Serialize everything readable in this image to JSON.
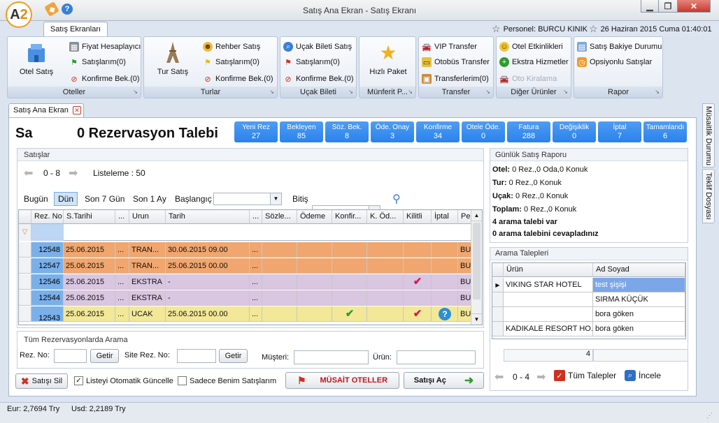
{
  "window": {
    "title": "Satış Ana Ekran - Satış Ekranı",
    "logo_text": "A",
    "logo_num": "2"
  },
  "ribbon_tab": "Satış Ekranları",
  "header_right": {
    "personel": "Personel: BURCU KINIK",
    "date": "26 Haziran 2015 Cuma 01:40:01"
  },
  "ribbon": {
    "oteller": {
      "label": "Oteller",
      "big": "Otel Satış",
      "items": [
        "Fiyat Hesaplayıcı",
        "Satışlarım(0)",
        "Konfirme Bek.(0)"
      ]
    },
    "turlar": {
      "label": "Turlar",
      "big": "Tur Satış",
      "items": [
        "Rehber Satış",
        "Satışlarım(0)",
        "Konfirme Bek.(0)"
      ]
    },
    "ucak": {
      "label": "Uçak Bileti",
      "items": [
        "Uçak Bileti Satış",
        "Satışlarım(0)",
        "Konfirme Bek.(0)"
      ]
    },
    "munferit": {
      "label": "Münferit P...",
      "big": "Hızlı Paket"
    },
    "transfer": {
      "label": "Transfer",
      "items": [
        "VIP Transfer",
        "Otobüs Transfer",
        "Transferlerim(0)"
      ]
    },
    "diger": {
      "label": "Diğer Ürünler",
      "items": [
        "Otel Etkinlikleri",
        "Ekstra Hizmetler",
        "Oto Kiralama"
      ]
    },
    "rapor": {
      "label": "Rapor",
      "items": [
        "Satış Bakiye Durumu",
        "Opsiyonlu Satışlar"
      ]
    }
  },
  "doc_tab": "Satış Ana Ekran",
  "main_title_short": "Sa",
  "rez_title": "0 Rezervasyon Talebi",
  "tiles": [
    {
      "label": "Yeni Rez",
      "value": "27"
    },
    {
      "label": "Bekleyen",
      "value": "85"
    },
    {
      "label": "Söz. Bek.",
      "value": "8"
    },
    {
      "label": "Öde. Onay",
      "value": "3"
    },
    {
      "label": "Konfirme",
      "value": "34"
    },
    {
      "label": "Otele Öde.",
      "value": "0"
    },
    {
      "label": "Fatura",
      "value": "288"
    },
    {
      "label": "Değişiklik",
      "value": "0"
    },
    {
      "label": "İptal",
      "value": "7"
    },
    {
      "label": "Tamamlandı",
      "value": "6"
    }
  ],
  "satislar": {
    "title": "Satışlar",
    "range": "0 - 8",
    "listeleme": "Listeleme : 50",
    "filters": [
      "Bugün",
      "Dün",
      "Son 7 Gün",
      "Son 1 Ay"
    ],
    "baslangic": "Başlangıç",
    "bitis": "Bitiş",
    "columns": [
      "Rez. No",
      "S.Tarihi",
      "...",
      "Urun",
      "Tarih",
      "...",
      "Sözle...",
      "Ödeme",
      "Konfir...",
      "K. Öd...",
      "Kilitli",
      "İptal",
      "Pe"
    ],
    "rows": [
      {
        "rez": "12548",
        "starih": "25.06.2015",
        "dots": "...",
        "urun": "TRAN...",
        "tarih": "30.06.2015 09.00",
        "dots2": "...",
        "pe": "BU",
        "color": "#f0a66e"
      },
      {
        "rez": "12547",
        "starih": "25.06.2015",
        "dots": "...",
        "urun": "TRAN...",
        "tarih": "25.06.2015 00.00",
        "dots2": "...",
        "pe": "BU",
        "color": "#f0a66e"
      },
      {
        "rez": "12546",
        "starih": "25.06.2015",
        "dots": "...",
        "urun": "EKSTRA",
        "tarih": "-",
        "dots2": "...",
        "pe": "BU",
        "color": "#d9c6e0"
      },
      {
        "rez": "12544",
        "starih": "25.06.2015",
        "dots": "...",
        "urun": "EKSTRA",
        "tarih": "-",
        "dots2": "...",
        "pe": "BU",
        "color": "#d9c6e0"
      },
      {
        "rez": "12543",
        "starih": "25.06.2015",
        "dots": "...",
        "urun": "UCAK",
        "tarih": "25.06.2015 00.00",
        "dots2": "...",
        "pe": "BU",
        "color": "#f2e898"
      }
    ]
  },
  "arama": {
    "title": "Tüm Rezervasyonlarda Arama",
    "rez_no": "Rez. No:",
    "getir": "Getir",
    "site_rez_no": "Site Rez. No:",
    "musteri": "Müşteri:",
    "urun": "Ürün:"
  },
  "bottom": {
    "satisi_sil": "Satışı Sil",
    "otomatik": "Listeyi Otomatik Güncelle",
    "sadece": "Sadece Benim Satışlarım",
    "musait": "MÜSAİT OTELLER",
    "satisi_ac": "Satışı Aç"
  },
  "gunluk": {
    "title": "Günlük Satış Raporu",
    "lines": [
      {
        "k": "Otel:",
        "v": "0 Rez.,0 Oda,0 Konuk"
      },
      {
        "k": "Tur:",
        "v": "0 Rez.,0 Konuk"
      },
      {
        "k": "Uçak:",
        "v": "0 Rez.,0 Konuk"
      },
      {
        "k": "Toplam:",
        "v": "0 Rez.,0 Konuk"
      }
    ],
    "note1": "4 arama talebi var",
    "note2": "0 arama talebini cevapladınız"
  },
  "talepler": {
    "title": "Arama Talepleri",
    "col_urun": "Ürün",
    "col_ad": "Ad Soyad",
    "rows": [
      {
        "urun": "VIKING STAR HOTEL",
        "ad": "test şişişi"
      },
      {
        "urun": "",
        "ad": "SIRMA KÜÇÜK"
      },
      {
        "urun": "",
        "ad": "bora göken"
      },
      {
        "urun": "KADIKALE RESORT HO...",
        "ad": "bora göken"
      }
    ],
    "count": "4",
    "range": "0 - 4",
    "tum": "Tüm Talepler",
    "incele": "İncele"
  },
  "vtabs": [
    "Müsaitlik Durumu",
    "Teklif Dosyası"
  ],
  "statusbar": {
    "eur": "Eur: 2,7694 Try",
    "usd": "Usd: 2,2189 Try"
  }
}
